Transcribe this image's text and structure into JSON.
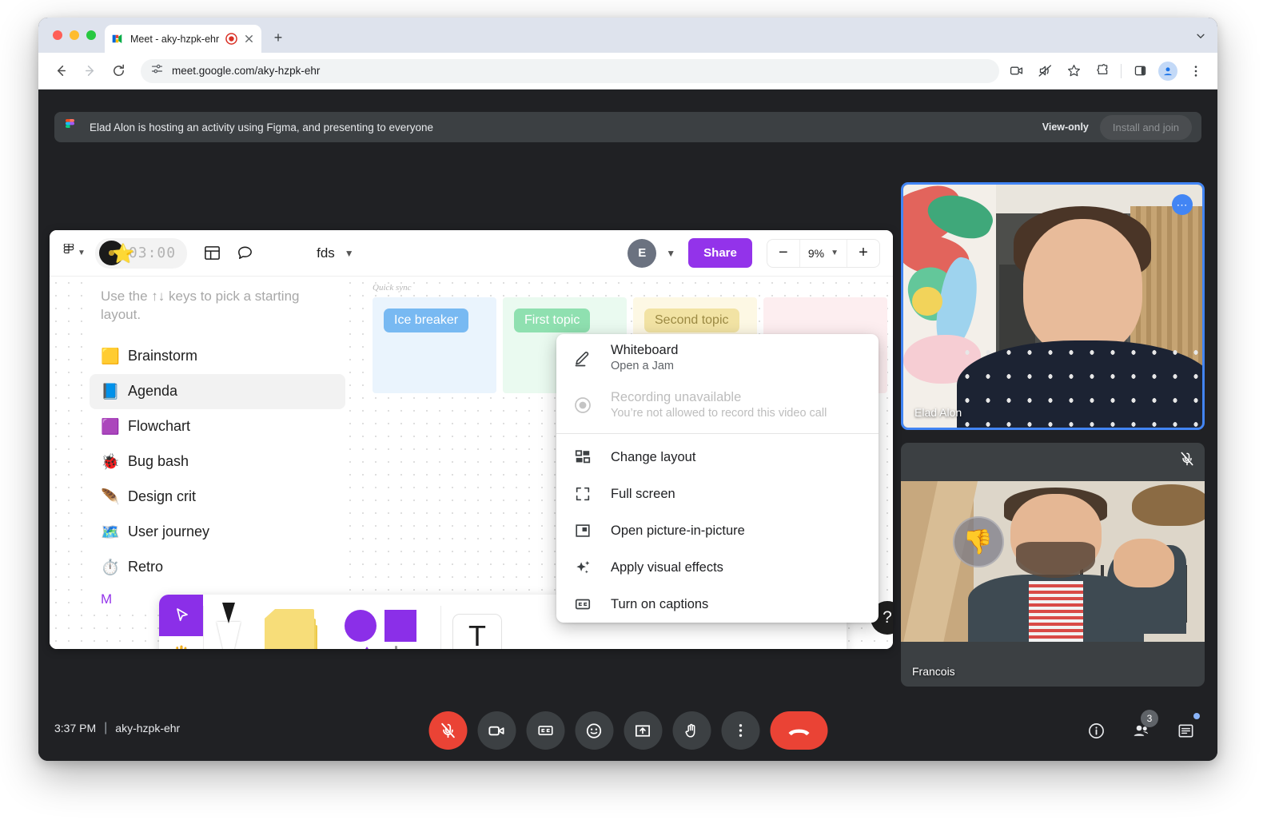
{
  "browser": {
    "tab": {
      "title": "Meet - aky-hzpk-ehr",
      "favicon_name": "google-meet-favicon",
      "recording_indicator": "recording-dot-icon",
      "close_icon": "close-icon"
    },
    "new_tab_label": "+",
    "url": "meet.google.com/aky-hzpk-ehr",
    "toolbar_icons": [
      "camera-blocked-icon",
      "sound-muted-icon",
      "bookmark-star-icon",
      "extensions-puzzle-icon",
      "side-panel-icon",
      "profile-avatar-icon",
      "kebab-menu-icon"
    ],
    "nav": {
      "back": "back-arrow-icon",
      "forward": "forward-arrow-icon",
      "reload": "reload-icon",
      "site_info": "site-settings-icon"
    }
  },
  "banner": {
    "icon": "figma-logo-icon",
    "text": "Elad Alon is hosting an activity using Figma, and presenting to everyone",
    "view_only": "View-only",
    "install_button": "Install and join"
  },
  "figma": {
    "toolbar": {
      "logo": "figma-logo-icon",
      "timer": "03:00",
      "layout_icon": "panel-layout-icon",
      "comment_icon": "comment-bubble-icon",
      "file_name": "fds",
      "avatar_initial": "E",
      "share_label": "Share",
      "zoom_minus": "−",
      "zoom_value": "9%",
      "zoom_plus": "+"
    },
    "panel": {
      "hint": "Use the ↑↓ keys to pick a starting layout.",
      "items": [
        {
          "emoji": "🟨",
          "label": "Brainstorm",
          "selected": false
        },
        {
          "emoji": "📘",
          "label": "Agenda",
          "selected": true
        },
        {
          "emoji": "🟪",
          "label": "Flowchart",
          "selected": false
        },
        {
          "emoji": "🐞",
          "label": "Bug bash",
          "selected": false
        },
        {
          "emoji": "🪶",
          "label": "Design crit",
          "selected": false
        },
        {
          "emoji": "🗺️",
          "label": "User journey",
          "selected": false
        },
        {
          "emoji": "⏱️",
          "label": "Retro",
          "selected": false
        }
      ],
      "more_label": "M"
    },
    "board": {
      "section_label": "Quick sync",
      "topics": [
        {
          "label": "Ice breaker",
          "style": "chip-blue"
        },
        {
          "label": "First topic",
          "style": "chip-green"
        },
        {
          "label": "Second topic",
          "style": "chip-yellow"
        }
      ]
    },
    "tools": [
      "cursor-tool-icon",
      "hand-tool-icon",
      "pen-tool-icon",
      "sticky-note-tool-icon",
      "shapes-tool-icon",
      "text-tool-icon"
    ],
    "help_label": "?"
  },
  "menu": {
    "items": [
      {
        "icon": "pencil-icon",
        "title": "Whiteboard",
        "subtitle": "Open a Jam",
        "disabled": false
      },
      {
        "icon": "record-circle-icon",
        "title": "Recording unavailable",
        "subtitle": "You’re not allowed to record this video call",
        "disabled": true
      },
      {
        "icon": "layout-grid-icon",
        "title": "Change layout",
        "subtitle": "",
        "disabled": false
      },
      {
        "icon": "fullscreen-icon",
        "title": "Full screen",
        "subtitle": "",
        "disabled": false
      },
      {
        "icon": "picture-in-picture-icon",
        "title": "Open picture-in-picture",
        "subtitle": "",
        "disabled": false
      },
      {
        "icon": "sparkles-icon",
        "title": "Apply visual effects",
        "subtitle": "",
        "disabled": false
      },
      {
        "icon": "closed-captions-icon",
        "title": "Turn on captions",
        "subtitle": "",
        "disabled": false
      }
    ]
  },
  "tiles": [
    {
      "name": "Elad Alon",
      "more_icon": "more-options-icon",
      "speaking": true,
      "muted": false
    },
    {
      "name": "Francois",
      "more_icon": "",
      "speaking": false,
      "muted": true,
      "reaction": "👎"
    }
  ],
  "bottom_bar": {
    "time": "3:37 PM",
    "separator": "|",
    "meeting_code": "aky-hzpk-ehr",
    "controls": [
      {
        "name": "microphone-muted-button",
        "state": "danger"
      },
      {
        "name": "camera-button",
        "state": "normal"
      },
      {
        "name": "captions-button",
        "state": "normal"
      },
      {
        "name": "reactions-button",
        "state": "normal"
      },
      {
        "name": "present-now-button",
        "state": "normal"
      },
      {
        "name": "raise-hand-button",
        "state": "normal"
      },
      {
        "name": "more-options-button",
        "state": "normal"
      },
      {
        "name": "leave-call-button",
        "state": "hangup"
      }
    ],
    "right_icons": [
      {
        "name": "meeting-details-button",
        "badge": ""
      },
      {
        "name": "participants-button",
        "badge": "3"
      },
      {
        "name": "chat-button",
        "badge": ""
      }
    ]
  },
  "colors": {
    "accent_blue": "#4285f4",
    "danger_red": "#ea4335",
    "figma_purple": "#9333ea",
    "meet_dark": "#202124",
    "meet_surface": "#3c4043"
  }
}
